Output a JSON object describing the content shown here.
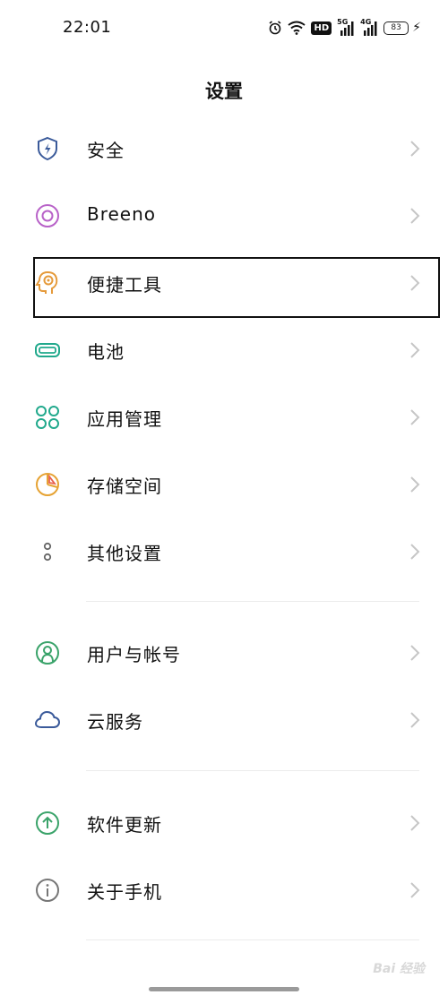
{
  "status_bar": {
    "time": "22:01",
    "hd": "HD",
    "net1": "5G",
    "net2": "4G",
    "battery": "83"
  },
  "header": {
    "title": "设置"
  },
  "sections": [
    {
      "items": [
        {
          "label": "安全",
          "icon": "shield-icon",
          "color": "#3a5a9a"
        },
        {
          "label": "Breeno",
          "icon": "breeno-icon",
          "color": "#b862c8"
        },
        {
          "label": "便捷工具",
          "icon": "convenience-tools-icon",
          "color": "#e59a3a"
        },
        {
          "label": "电池",
          "icon": "battery-icon",
          "color": "#21a98c"
        },
        {
          "label": "应用管理",
          "icon": "apps-icon",
          "color": "#21a98c"
        },
        {
          "label": "存储空间",
          "icon": "storage-icon",
          "color": "#e6a334"
        },
        {
          "label": "其他设置",
          "icon": "more-settings-icon",
          "color": "#666666"
        }
      ]
    },
    {
      "items": [
        {
          "label": "用户与帐号",
          "icon": "user-account-icon",
          "color": "#3aa36a"
        },
        {
          "label": "云服务",
          "icon": "cloud-icon",
          "color": "#3a5a9a"
        }
      ]
    },
    {
      "items": [
        {
          "label": "软件更新",
          "icon": "software-update-icon",
          "color": "#3aa36a"
        },
        {
          "label": "关于手机",
          "icon": "about-phone-icon",
          "color": "#777777"
        }
      ]
    }
  ],
  "watermark": "Bai 经验"
}
